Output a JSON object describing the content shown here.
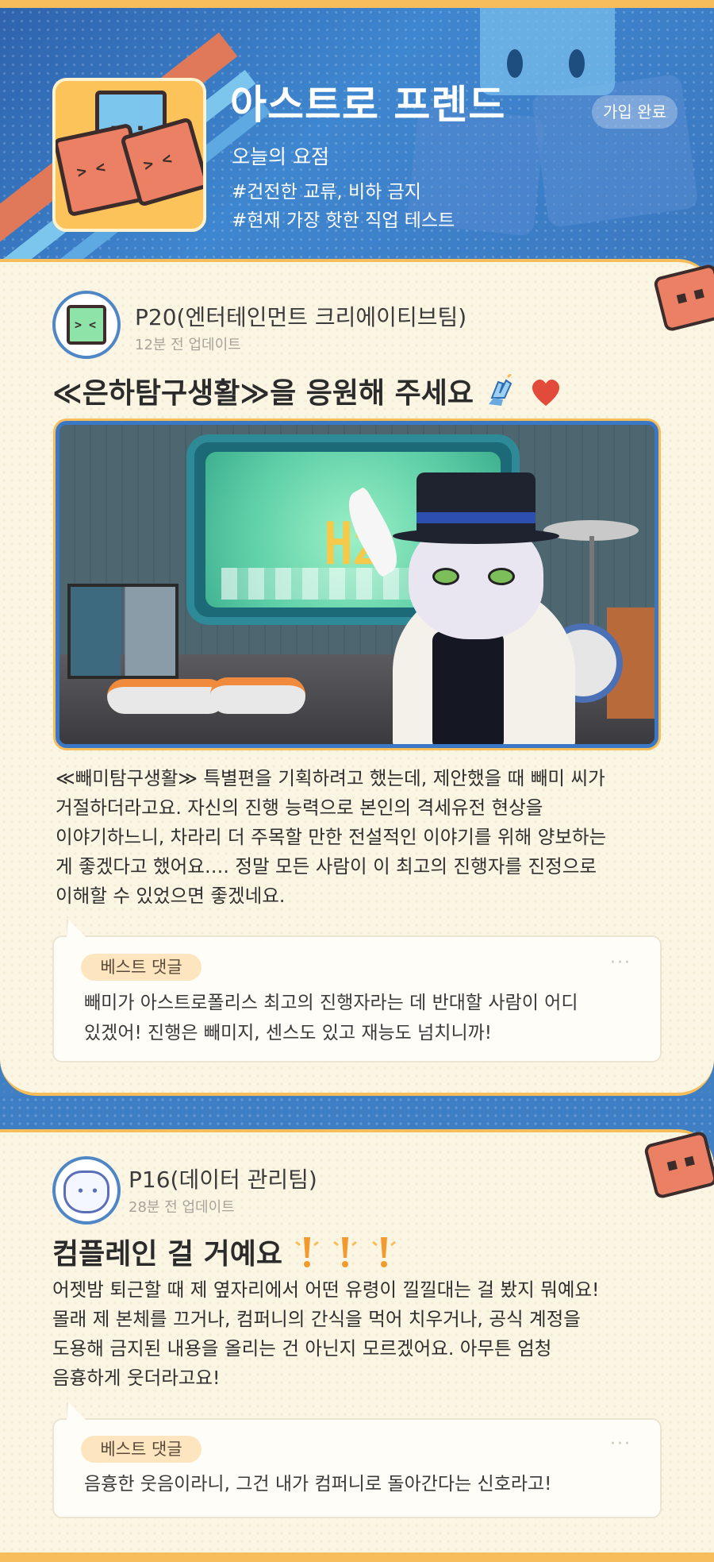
{
  "header": {
    "title": "아스트로 프렌드",
    "subtitle": "오늘의 요점",
    "tags": [
      "#건전한 교류, 비하 금지",
      "#현재 가장 핫한 직업 테스트"
    ],
    "joined_label": "가입 완료"
  },
  "posts": [
    {
      "author": "P20(엔터테인먼트 크리에이티브팀)",
      "time": "12분 전 업데이트",
      "title": "≪은하탐구생활≫을 응원해 주세요",
      "title_icons": [
        "clapping-hands-icon",
        "heart-icon"
      ],
      "image_logo_text": "㎐",
      "body_lines": [
        "≪빼미탐구생활≫ 특별편을 기획하려고 했는데, 제안했을 때 빼미 씨가",
        "거절하더라고요. 자신의 진행 능력으로 본인의 격세유전 현상을",
        "이야기하느니, 차라리 더 주목할 만한 전설적인 이야기를 위해 양보하는",
        "게 좋겠다고 했어요…. 정말 모든 사람이 이 최고의 진행자를 진정으로",
        "이해할 수 있었으면 좋겠네요."
      ],
      "best_comment": {
        "label": "베스트 댓글",
        "more": "···",
        "lines": [
          "빼미가 아스트로폴리스 최고의 진행자라는 데 반대할 사람이 어디",
          "있겠어! 진행은 빼미지, 센스도 있고 재능도 넘치니까!"
        ]
      }
    },
    {
      "author": "P16(데이터 관리팀)",
      "time": "28분 전 업데이트",
      "title": "컴플레인 걸 거예요",
      "title_icons": [
        "exclamation-icon",
        "exclamation-icon",
        "exclamation-icon"
      ],
      "body_lines": [
        "어젯밤 퇴근할 때 제 옆자리에서 어떤 유령이 낄낄대는 걸 봤지 뭐예요!",
        "몰래 제 본체를 끄거나, 컴퍼니의 간식을 먹어 치우거나, 공식 계정을",
        "도용해 금지된 내용을 올리는 건 아닌지 모르겠어요. 아무튼 엄청",
        "음흉하게 웃더라고요!"
      ],
      "best_comment": {
        "label": "베스트 댓글",
        "more": "···",
        "lines": [
          "음흉한 웃음이라니, 그건 내가 컴퍼니로 돌아간다는 신호라고!"
        ]
      }
    }
  ],
  "colors": {
    "header_blue": "#3e86cf",
    "card_bg": "#fbf5e3",
    "accent_yellow": "#f6bd5a",
    "cube_red": "#ec8064"
  }
}
